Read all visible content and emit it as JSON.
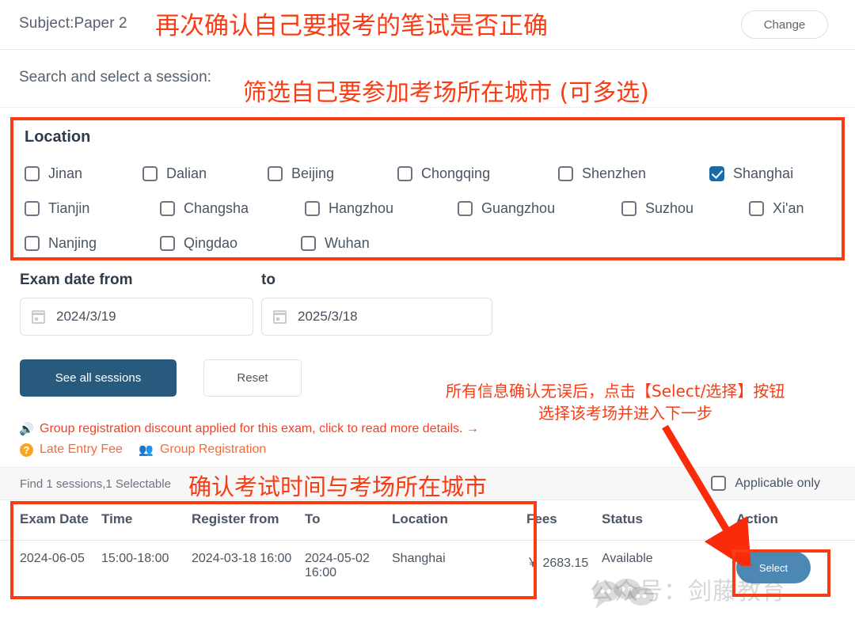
{
  "header": {
    "subject_label": "Subject:Paper 2",
    "change_button": "Change"
  },
  "search": {
    "label": "Search and select a session:"
  },
  "location": {
    "title": "Location",
    "items": [
      {
        "label": "Jinan",
        "checked": false
      },
      {
        "label": "Dalian",
        "checked": false
      },
      {
        "label": "Beijing",
        "checked": false
      },
      {
        "label": "Chongqing",
        "checked": false
      },
      {
        "label": "Shenzhen",
        "checked": false
      },
      {
        "label": "Shanghai",
        "checked": true
      },
      {
        "label": "Tianjin",
        "checked": false
      },
      {
        "label": "Changsha",
        "checked": false
      },
      {
        "label": "Hangzhou",
        "checked": false
      },
      {
        "label": "Guangzhou",
        "checked": false
      },
      {
        "label": "Suzhou",
        "checked": false
      },
      {
        "label": "Xi'an",
        "checked": false
      },
      {
        "label": "Nanjing",
        "checked": false
      },
      {
        "label": "Qingdao",
        "checked": false
      },
      {
        "label": "Wuhan",
        "checked": false
      }
    ]
  },
  "date_filter": {
    "from_label": "Exam date from",
    "to_label": "to",
    "from_value": "2024/3/19",
    "to_value": "2025/3/18",
    "calendar_icon": "calendar-icon"
  },
  "actions": {
    "see_all_sessions": "See all sessions",
    "reset": "Reset"
  },
  "notices": {
    "group_discount": "Group registration discount applied for this exam, click to read more details. →",
    "late_entry_fee": "Late Entry Fee",
    "group_registration": "Group Registration",
    "speaker_icon": "speaker-icon",
    "help_icon": "help-circle-icon",
    "group_icon": "group-people-icon"
  },
  "results": {
    "count_text": "Find 1 sessions,1 Selectable",
    "applicable_only": "Applicable only",
    "applicable_checked": false
  },
  "table": {
    "columns": [
      "Exam Date",
      "Time",
      "Register from",
      "To",
      "Location",
      "Fees",
      "Status",
      "Action"
    ],
    "rows": [
      {
        "exam_date": "2024-06-05",
        "time": "15:00-18:00",
        "register_from": "2024-03-18 16:00",
        "to": "2024-05-02 16:00",
        "location": "Shanghai",
        "fees": "￥ 2683.15",
        "status": "Available",
        "action": "Select"
      }
    ]
  },
  "annotations": {
    "title_note": "再次确认自己要报考的笔试是否正确",
    "filter_note": "筛选自己要参加考场所在城市 (可多选)",
    "confirm_note": "确认考试时间与考场所在城市",
    "select_note_line1": "所有信息确认无误后，点击【Select/选择】按钮",
    "select_note_line2": "选择该考场并进入下一步",
    "arrow": "down-right-arrow"
  },
  "watermark": {
    "text": "公众号：剑藤教育"
  },
  "colors": {
    "annotation_red": "#fa3c14",
    "primary_blue": "#275a7d",
    "checkbox_blue": "#1b6aa5",
    "select_blue": "#3f7fad",
    "available_green": "#3f9d4a",
    "notice_orange": "#f26b3a"
  }
}
